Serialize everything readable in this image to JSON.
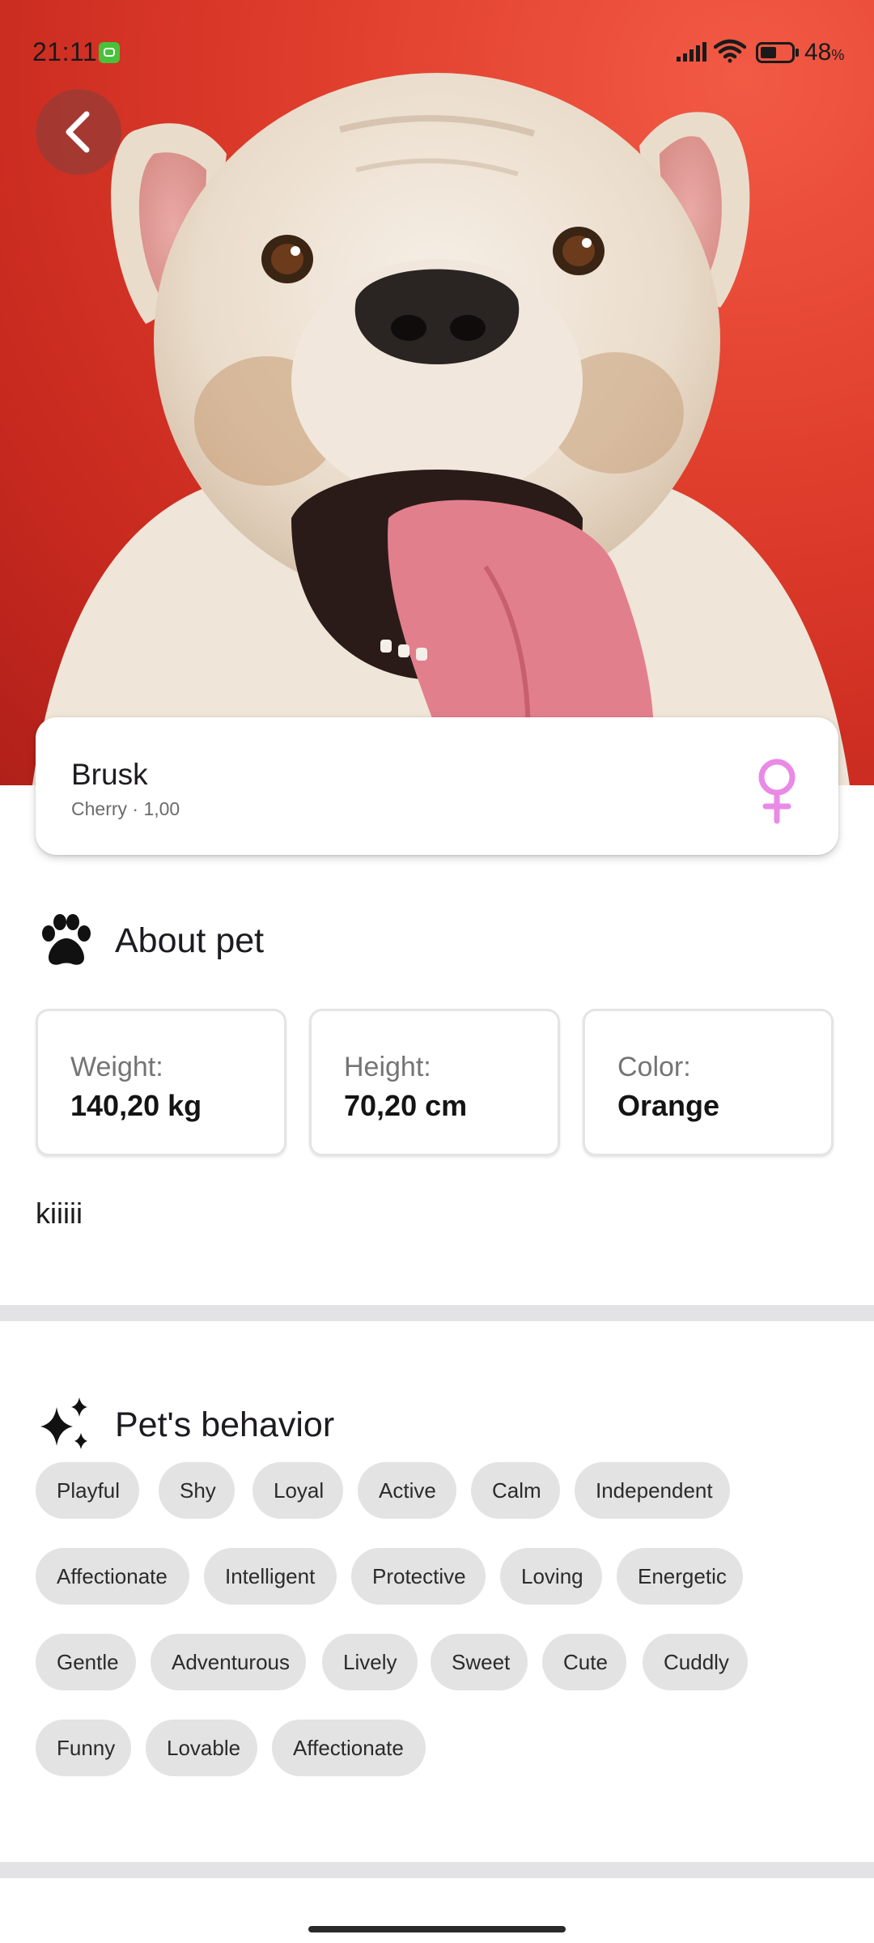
{
  "status_bar": {
    "time": "21:11",
    "battery_value": "48",
    "battery_unit": "%"
  },
  "pet": {
    "name": "Brusk",
    "subtitle": "Cherry · 1,00",
    "gender": "female",
    "gender_color": "#e98ae6"
  },
  "about": {
    "title": "About pet",
    "stats": [
      {
        "label": "Weight:",
        "value": "140,20 kg"
      },
      {
        "label": "Height:",
        "value": "70,20 cm"
      },
      {
        "label": "Color:",
        "value": "Orange"
      }
    ],
    "description": "kiiiii"
  },
  "behavior": {
    "title": "Pet's behavior",
    "tags": [
      "Playful",
      "Shy",
      "Loyal",
      "Active",
      "Calm",
      "Independent",
      "Affectionate",
      "Intelligent",
      "Protective",
      "Loving",
      "Energetic",
      "Gentle",
      "Adventurous",
      "Lively",
      "Sweet",
      "Cute",
      "Cuddly",
      "Funny",
      "Lovable",
      "Affectionate"
    ]
  },
  "colors": {
    "hero_background": "#e03e2d",
    "chip_background": "#e3e3e3",
    "divider": "#e3e3e6"
  },
  "icons": {
    "back": "chevron-left-icon",
    "gender": "female-icon",
    "about": "paw-icon",
    "behavior": "sparkles-icon"
  }
}
